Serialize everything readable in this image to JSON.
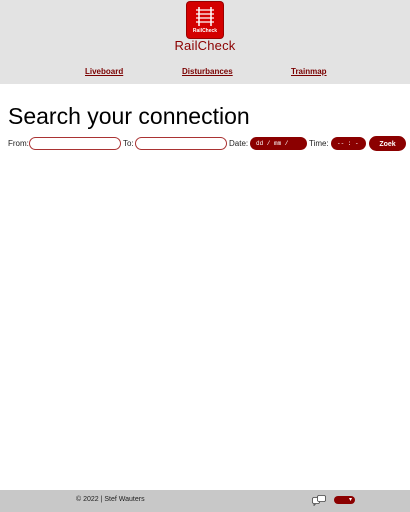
{
  "header": {
    "logo_text": "RailCheck",
    "brand": "RailCheck",
    "nav": [
      "Liveboard",
      "Disturbances",
      "Trainmap"
    ]
  },
  "main": {
    "title": "Search your connection",
    "from_label": "From:",
    "to_label": "To:",
    "date_label": "Date:",
    "date_placeholder": "dd / mm / jjjj",
    "time_label": "Time:",
    "time_placeholder": "-- : --",
    "search_button": "Zoek"
  },
  "footer": {
    "copyright": "© 2022 | Stef Wauters"
  },
  "colors": {
    "accent": "#8b0000",
    "logo_red": "#d40000",
    "header_bg": "#e3e3e3",
    "footer_bg": "#c8c8c8"
  }
}
